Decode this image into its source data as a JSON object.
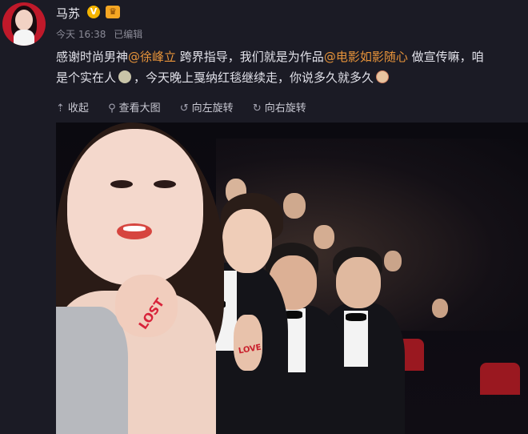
{
  "user": {
    "name": "马苏",
    "v_badge": "V"
  },
  "meta": {
    "time": "今天 16:38",
    "edited": "已编辑"
  },
  "post": {
    "line1_a": "感谢时尚男神",
    "mention1": "@徐峰立",
    "line1_b": " 跨界指导，我们就是为作品",
    "mention2": "@电影如影随心",
    "line1_c": " 做宣传嘛，咱",
    "line2_a": "是个实在人",
    "line2_b": "，今天晚上戛纳红毯继续走，你说多久就多久"
  },
  "toolbar": {
    "collapse": "收起",
    "view_large": "查看大图",
    "rotate_left": "向左旋转",
    "rotate_right": "向右旋转"
  },
  "photo": {
    "hand_text": "LOST",
    "finger_text": "LOVE"
  },
  "colors": {
    "link": "#e8943a",
    "background": "#1b1b25"
  }
}
